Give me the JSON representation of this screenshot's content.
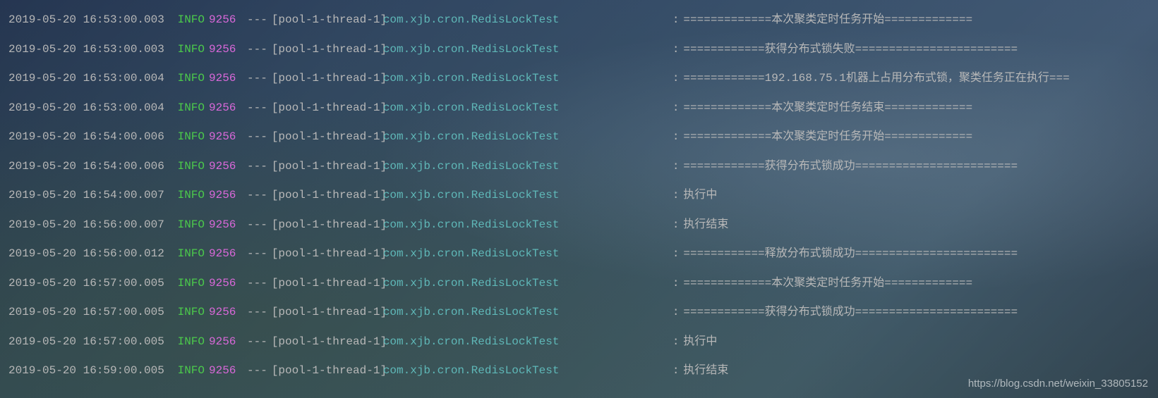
{
  "watermark": "https://blog.csdn.net/weixin_33805152",
  "separator": "---",
  "colon": ":",
  "logs": [
    {
      "timestamp": "2019-05-20 16:53:00.003",
      "level": "INFO",
      "pid": "9256",
      "thread": "[pool-1-thread-1]",
      "logger": "com.xjb.cron.RedisLockTest",
      "message": "=============本次聚类定时任务开始============="
    },
    {
      "timestamp": "2019-05-20 16:53:00.003",
      "level": "INFO",
      "pid": "9256",
      "thread": "[pool-1-thread-1]",
      "logger": "com.xjb.cron.RedisLockTest",
      "message": "============获得分布式锁失败========================"
    },
    {
      "timestamp": "2019-05-20 16:53:00.004",
      "level": "INFO",
      "pid": "9256",
      "thread": "[pool-1-thread-1]",
      "logger": "com.xjb.cron.RedisLockTest",
      "message": "============192.168.75.1机器上占用分布式锁，聚类任务正在执行==="
    },
    {
      "timestamp": "2019-05-20 16:53:00.004",
      "level": "INFO",
      "pid": "9256",
      "thread": "[pool-1-thread-1]",
      "logger": "com.xjb.cron.RedisLockTest",
      "message": "=============本次聚类定时任务结束============="
    },
    {
      "timestamp": "2019-05-20 16:54:00.006",
      "level": "INFO",
      "pid": "9256",
      "thread": "[pool-1-thread-1]",
      "logger": "com.xjb.cron.RedisLockTest",
      "message": "=============本次聚类定时任务开始============="
    },
    {
      "timestamp": "2019-05-20 16:54:00.006",
      "level": "INFO",
      "pid": "9256",
      "thread": "[pool-1-thread-1]",
      "logger": "com.xjb.cron.RedisLockTest",
      "message": "============获得分布式锁成功========================"
    },
    {
      "timestamp": "2019-05-20 16:54:00.007",
      "level": "INFO",
      "pid": "9256",
      "thread": "[pool-1-thread-1]",
      "logger": "com.xjb.cron.RedisLockTest",
      "message": "执行中"
    },
    {
      "timestamp": "2019-05-20 16:56:00.007",
      "level": "INFO",
      "pid": "9256",
      "thread": "[pool-1-thread-1]",
      "logger": "com.xjb.cron.RedisLockTest",
      "message": "执行结束"
    },
    {
      "timestamp": "2019-05-20 16:56:00.012",
      "level": "INFO",
      "pid": "9256",
      "thread": "[pool-1-thread-1]",
      "logger": "com.xjb.cron.RedisLockTest",
      "message": "============释放分布式锁成功========================"
    },
    {
      "timestamp": "2019-05-20 16:57:00.005",
      "level": "INFO",
      "pid": "9256",
      "thread": "[pool-1-thread-1]",
      "logger": "com.xjb.cron.RedisLockTest",
      "message": "=============本次聚类定时任务开始============="
    },
    {
      "timestamp": "2019-05-20 16:57:00.005",
      "level": "INFO",
      "pid": "9256",
      "thread": "[pool-1-thread-1]",
      "logger": "com.xjb.cron.RedisLockTest",
      "message": "============获得分布式锁成功========================"
    },
    {
      "timestamp": "2019-05-20 16:57:00.005",
      "level": "INFO",
      "pid": "9256",
      "thread": "[pool-1-thread-1]",
      "logger": "com.xjb.cron.RedisLockTest",
      "message": "执行中"
    },
    {
      "timestamp": "2019-05-20 16:59:00.005",
      "level": "INFO",
      "pid": "9256",
      "thread": "[pool-1-thread-1]",
      "logger": "com.xjb.cron.RedisLockTest",
      "message": "执行结束"
    }
  ]
}
